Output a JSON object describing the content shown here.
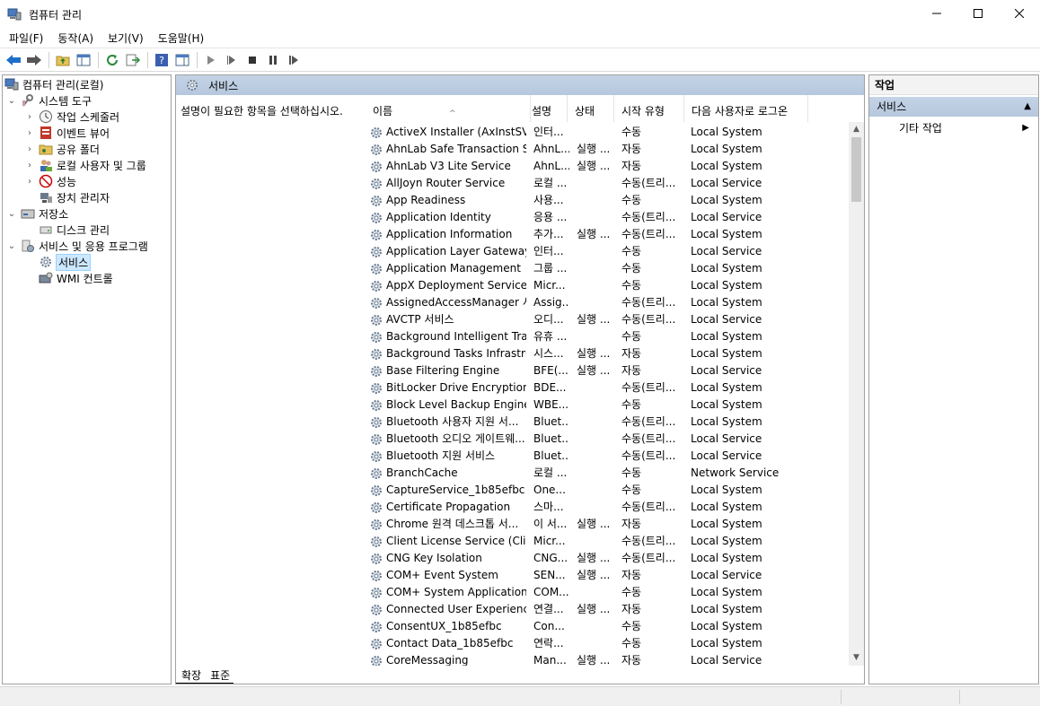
{
  "window": {
    "title": "컴퓨터 관리",
    "minimize": "—",
    "maximize": "☐",
    "close": "✕"
  },
  "menu": [
    "파일(F)",
    "동작(A)",
    "보기(V)",
    "도움말(H)"
  ],
  "tree": {
    "items": [
      {
        "label": "컴퓨터 관리(로컬)",
        "icon": "computer-management-icon",
        "expander": ""
      },
      {
        "label": "시스템 도구",
        "icon": "system-tools-icon",
        "expander": "⌄"
      },
      {
        "label": "작업 스케줄러",
        "icon": "task-scheduler-icon",
        "expander": "›"
      },
      {
        "label": "이벤트 뷰어",
        "icon": "event-viewer-icon",
        "expander": "›"
      },
      {
        "label": "공유 폴더",
        "icon": "shared-folders-icon",
        "expander": "›"
      },
      {
        "label": "로컬 사용자 및 그룹",
        "icon": "local-users-icon",
        "expander": "›"
      },
      {
        "label": "성능",
        "icon": "performance-icon",
        "expander": "›"
      },
      {
        "label": "장치 관리자",
        "icon": "device-manager-icon",
        "expander": ""
      },
      {
        "label": "저장소",
        "icon": "storage-icon",
        "expander": "⌄"
      },
      {
        "label": "디스크 관리",
        "icon": "disk-management-icon",
        "expander": ""
      },
      {
        "label": "서비스 및 응용 프로그램",
        "icon": "services-apps-icon",
        "expander": "⌄"
      },
      {
        "label": "서비스",
        "icon": "services-icon",
        "expander": ""
      },
      {
        "label": "WMI 컨트롤",
        "icon": "wmi-control-icon",
        "expander": ""
      }
    ]
  },
  "center": {
    "title": "서비스",
    "description": "설명이 필요한 항목을 선택하십시오.",
    "columns": {
      "name": "이름",
      "desc": "설명",
      "status": "상태",
      "start": "시작 유형",
      "logon": "다음 사용자로 로그온"
    },
    "sort_arrow": "^",
    "tabs": [
      "확장",
      "표준"
    ]
  },
  "services": [
    {
      "name": "ActiveX Installer (AxInstSV)",
      "desc": "인터...",
      "status": "",
      "start": "수동",
      "logon": "Local System"
    },
    {
      "name": "AhnLab Safe Transaction S...",
      "desc": "AhnL...",
      "status": "실행 ...",
      "start": "자동",
      "logon": "Local System"
    },
    {
      "name": "AhnLab V3 Lite Service",
      "desc": "AhnL...",
      "status": "실행 ...",
      "start": "자동",
      "logon": "Local System"
    },
    {
      "name": "AllJoyn Router Service",
      "desc": "로컬 ...",
      "status": "",
      "start": "수동(트리...",
      "logon": "Local Service"
    },
    {
      "name": "App Readiness",
      "desc": "사용...",
      "status": "",
      "start": "수동",
      "logon": "Local System"
    },
    {
      "name": "Application Identity",
      "desc": "응용 ...",
      "status": "",
      "start": "수동(트리...",
      "logon": "Local Service"
    },
    {
      "name": "Application Information",
      "desc": "추가...",
      "status": "실행 ...",
      "start": "수동(트리...",
      "logon": "Local System"
    },
    {
      "name": "Application Layer Gateway ...",
      "desc": "인터...",
      "status": "",
      "start": "수동",
      "logon": "Local Service"
    },
    {
      "name": "Application Management",
      "desc": "그룹 ...",
      "status": "",
      "start": "수동",
      "logon": "Local System"
    },
    {
      "name": "AppX Deployment Service ...",
      "desc": "Micr...",
      "status": "",
      "start": "수동",
      "logon": "Local System"
    },
    {
      "name": "AssignedAccessManager 서...",
      "desc": "Assig...",
      "status": "",
      "start": "수동(트리...",
      "logon": "Local System"
    },
    {
      "name": "AVCTP 서비스",
      "desc": "오디...",
      "status": "실행 ...",
      "start": "수동(트리...",
      "logon": "Local Service"
    },
    {
      "name": "Background Intelligent Tra...",
      "desc": "유휴 ...",
      "status": "",
      "start": "수동",
      "logon": "Local System"
    },
    {
      "name": "Background Tasks Infrastru...",
      "desc": "시스...",
      "status": "실행 ...",
      "start": "자동",
      "logon": "Local System"
    },
    {
      "name": "Base Filtering Engine",
      "desc": "BFE(...",
      "status": "실행 ...",
      "start": "자동",
      "logon": "Local Service"
    },
    {
      "name": "BitLocker Drive Encryption ...",
      "desc": "BDE...",
      "status": "",
      "start": "수동(트리...",
      "logon": "Local System"
    },
    {
      "name": "Block Level Backup Engine ...",
      "desc": "WBE...",
      "status": "",
      "start": "수동",
      "logon": "Local System"
    },
    {
      "name": "Bluetooth 사용자 지원 서...",
      "desc": "Bluet...",
      "status": "",
      "start": "수동(트리...",
      "logon": "Local System"
    },
    {
      "name": "Bluetooth 오디오 게이트웨...",
      "desc": "Bluet...",
      "status": "",
      "start": "수동(트리...",
      "logon": "Local Service"
    },
    {
      "name": "Bluetooth 지원 서비스",
      "desc": "Bluet...",
      "status": "",
      "start": "수동(트리...",
      "logon": "Local Service"
    },
    {
      "name": "BranchCache",
      "desc": "로컬 ...",
      "status": "",
      "start": "수동",
      "logon": "Network Service"
    },
    {
      "name": "CaptureService_1b85efbc",
      "desc": "One...",
      "status": "",
      "start": "수동",
      "logon": "Local System"
    },
    {
      "name": "Certificate Propagation",
      "desc": "스마...",
      "status": "",
      "start": "수동(트리...",
      "logon": "Local System"
    },
    {
      "name": "Chrome 원격 데스크톱 서...",
      "desc": "이 서...",
      "status": "실행 ...",
      "start": "자동",
      "logon": "Local System"
    },
    {
      "name": "Client License Service (Clip...",
      "desc": "Micr...",
      "status": "",
      "start": "수동(트리...",
      "logon": "Local System"
    },
    {
      "name": "CNG Key Isolation",
      "desc": "CNG...",
      "status": "실행 ...",
      "start": "수동(트리...",
      "logon": "Local System"
    },
    {
      "name": "COM+ Event System",
      "desc": "SEN...",
      "status": "실행 ...",
      "start": "자동",
      "logon": "Local Service"
    },
    {
      "name": "COM+ System Application",
      "desc": "COM...",
      "status": "",
      "start": "수동",
      "logon": "Local System"
    },
    {
      "name": "Connected User Experience...",
      "desc": "연결...",
      "status": "실행 ...",
      "start": "자동",
      "logon": "Local System"
    },
    {
      "name": "ConsentUX_1b85efbc",
      "desc": "Con...",
      "status": "",
      "start": "수동",
      "logon": "Local System"
    },
    {
      "name": "Contact Data_1b85efbc",
      "desc": "연락...",
      "status": "",
      "start": "수동",
      "logon": "Local System"
    },
    {
      "name": "CoreMessaging",
      "desc": "Man...",
      "status": "실행 ...",
      "start": "자동",
      "logon": "Local Service"
    }
  ],
  "actions": {
    "header": "작업",
    "section": "서비스",
    "section_caret": "▲",
    "item": "기타 작업",
    "item_caret": "▶"
  },
  "scroll": {
    "up": "▲",
    "down": "▼"
  },
  "colors": {
    "header_band": "#b8cadf",
    "selection": "#cce8ff",
    "accent_blue": "#1e6fc9"
  }
}
